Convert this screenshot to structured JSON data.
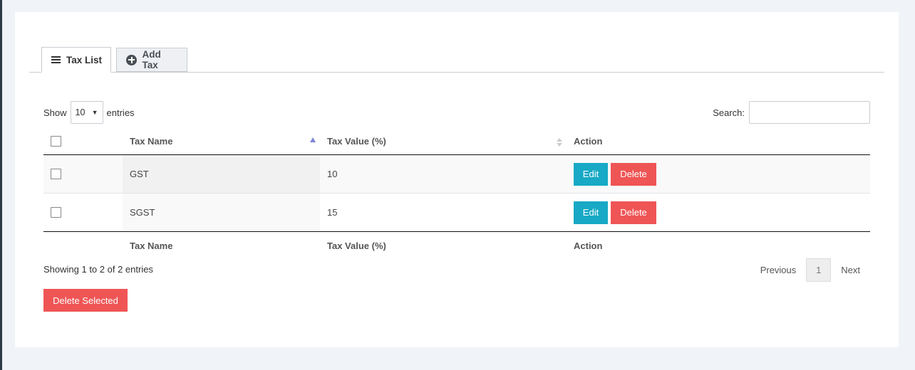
{
  "tabs": [
    {
      "label": "Tax List",
      "icon": "list-icon",
      "active": true
    },
    {
      "label": "Add Tax",
      "icon": "plus-circle-icon",
      "active": false
    }
  ],
  "length_menu": {
    "prefix": "Show",
    "value": "10",
    "suffix": "entries"
  },
  "search": {
    "label": "Search:",
    "value": "",
    "placeholder": ""
  },
  "table": {
    "columns": [
      "Tax Name",
      "Tax Value (%)",
      "Action"
    ],
    "rows": [
      {
        "name": "GST",
        "value": "10",
        "edit_label": "Edit",
        "delete_label": "Delete"
      },
      {
        "name": "SGST",
        "value": "15",
        "edit_label": "Edit",
        "delete_label": "Delete"
      }
    ],
    "footer": [
      "Tax Name",
      "Tax Value (%)",
      "Action"
    ]
  },
  "info": "Showing 1 to 2 of 2 entries",
  "pagination": {
    "previous": "Previous",
    "current": "1",
    "next": "Next"
  },
  "delete_selected_label": "Delete Selected",
  "colors": {
    "edit": "#17a9c5",
    "delete": "#ef5555",
    "sort_active": "#7b86d6",
    "background": "#f0f3f7"
  }
}
